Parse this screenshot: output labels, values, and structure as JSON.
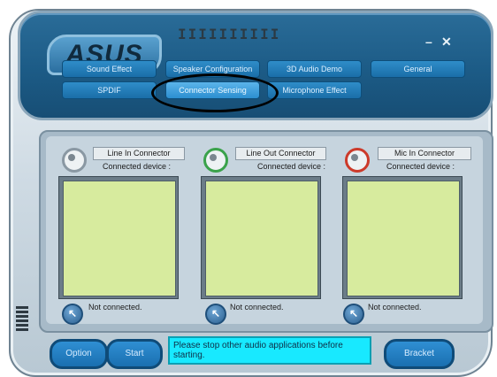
{
  "tabs_row1": [
    "Sound Effect",
    "Speaker Configuration",
    "3D Audio Demo",
    "General"
  ],
  "tabs_row2": [
    "SPDIF",
    "Connector Sensing",
    "Microphone Effect"
  ],
  "connectors": [
    {
      "title": "Line In Connector",
      "device_label": "Connected device :",
      "status": "Not connected."
    },
    {
      "title": "Line Out Connector",
      "device_label": "Connected device :",
      "status": "Not connected."
    },
    {
      "title": "Mic In Connector",
      "device_label": "Connected device :",
      "status": "Not connected."
    }
  ],
  "bottom": {
    "option": "Option",
    "start": "Start",
    "message": "Please stop other audio applications before starting.",
    "bracket": "Bracket"
  },
  "logo": "ASUS"
}
